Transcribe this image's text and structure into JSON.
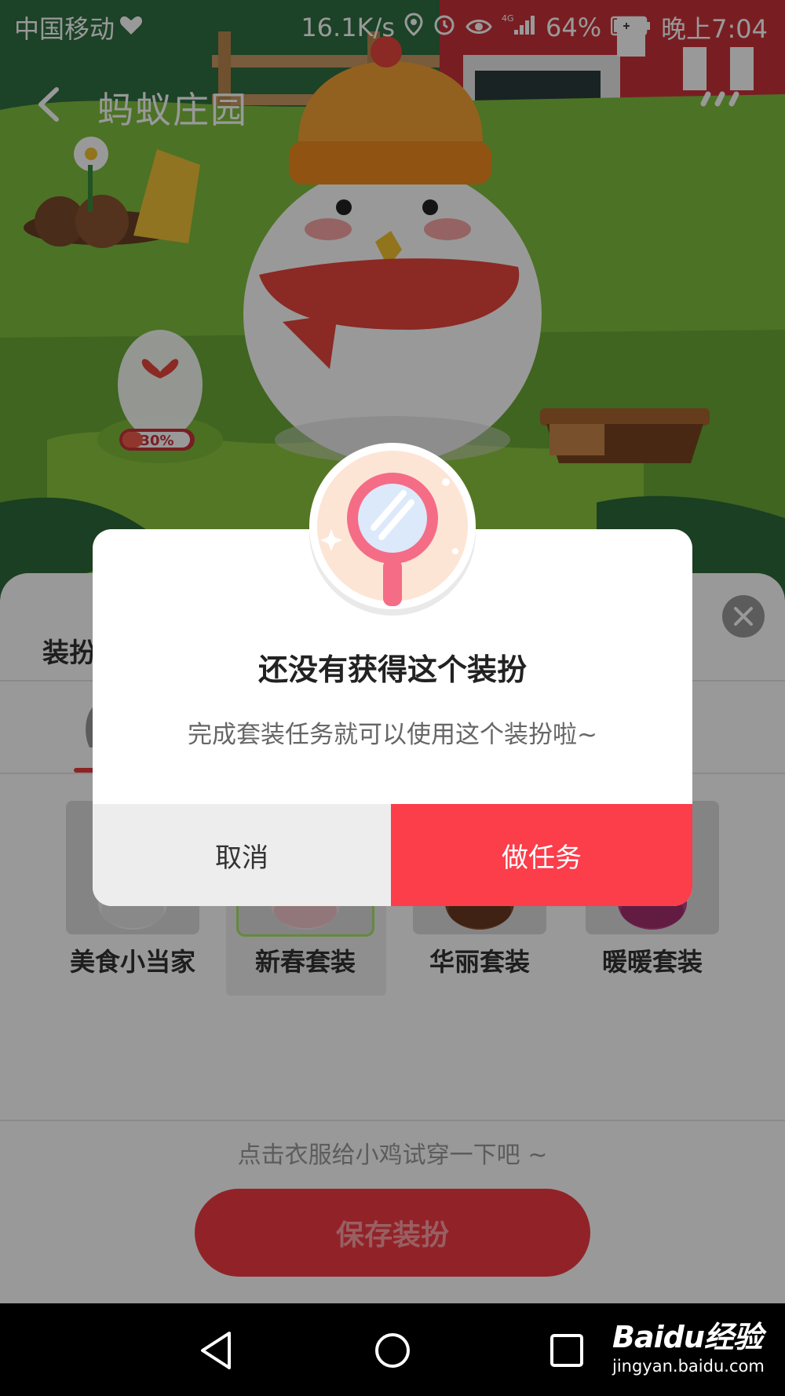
{
  "status_bar": {
    "carrier": "中国移动",
    "speed": "16.1K/s",
    "network": "4G",
    "battery": "64%",
    "time": "晚上7:04"
  },
  "nav": {
    "title": "蚂蚁庄园"
  },
  "farm": {
    "egg_progress": "30%"
  },
  "sheet": {
    "title": "装扮",
    "outfits": [
      {
        "label": "美食小当家"
      },
      {
        "label": "新春套装"
      },
      {
        "label": "华丽套装"
      },
      {
        "label": "暖暖套装"
      }
    ],
    "hint": "点击衣服给小鸡试穿一下吧 ~",
    "save_label": "保存装扮"
  },
  "dialog": {
    "title": "还没有获得这个装扮",
    "message": "完成套装任务就可以使用这个装扮啦~",
    "cancel_label": "取消",
    "confirm_label": "做任务"
  },
  "watermark": {
    "logo": "Baidu经验",
    "url": "jingyan.baidu.com"
  },
  "colors": {
    "accent_red": "#fc3d4a",
    "farm_green": "#76b63c"
  }
}
